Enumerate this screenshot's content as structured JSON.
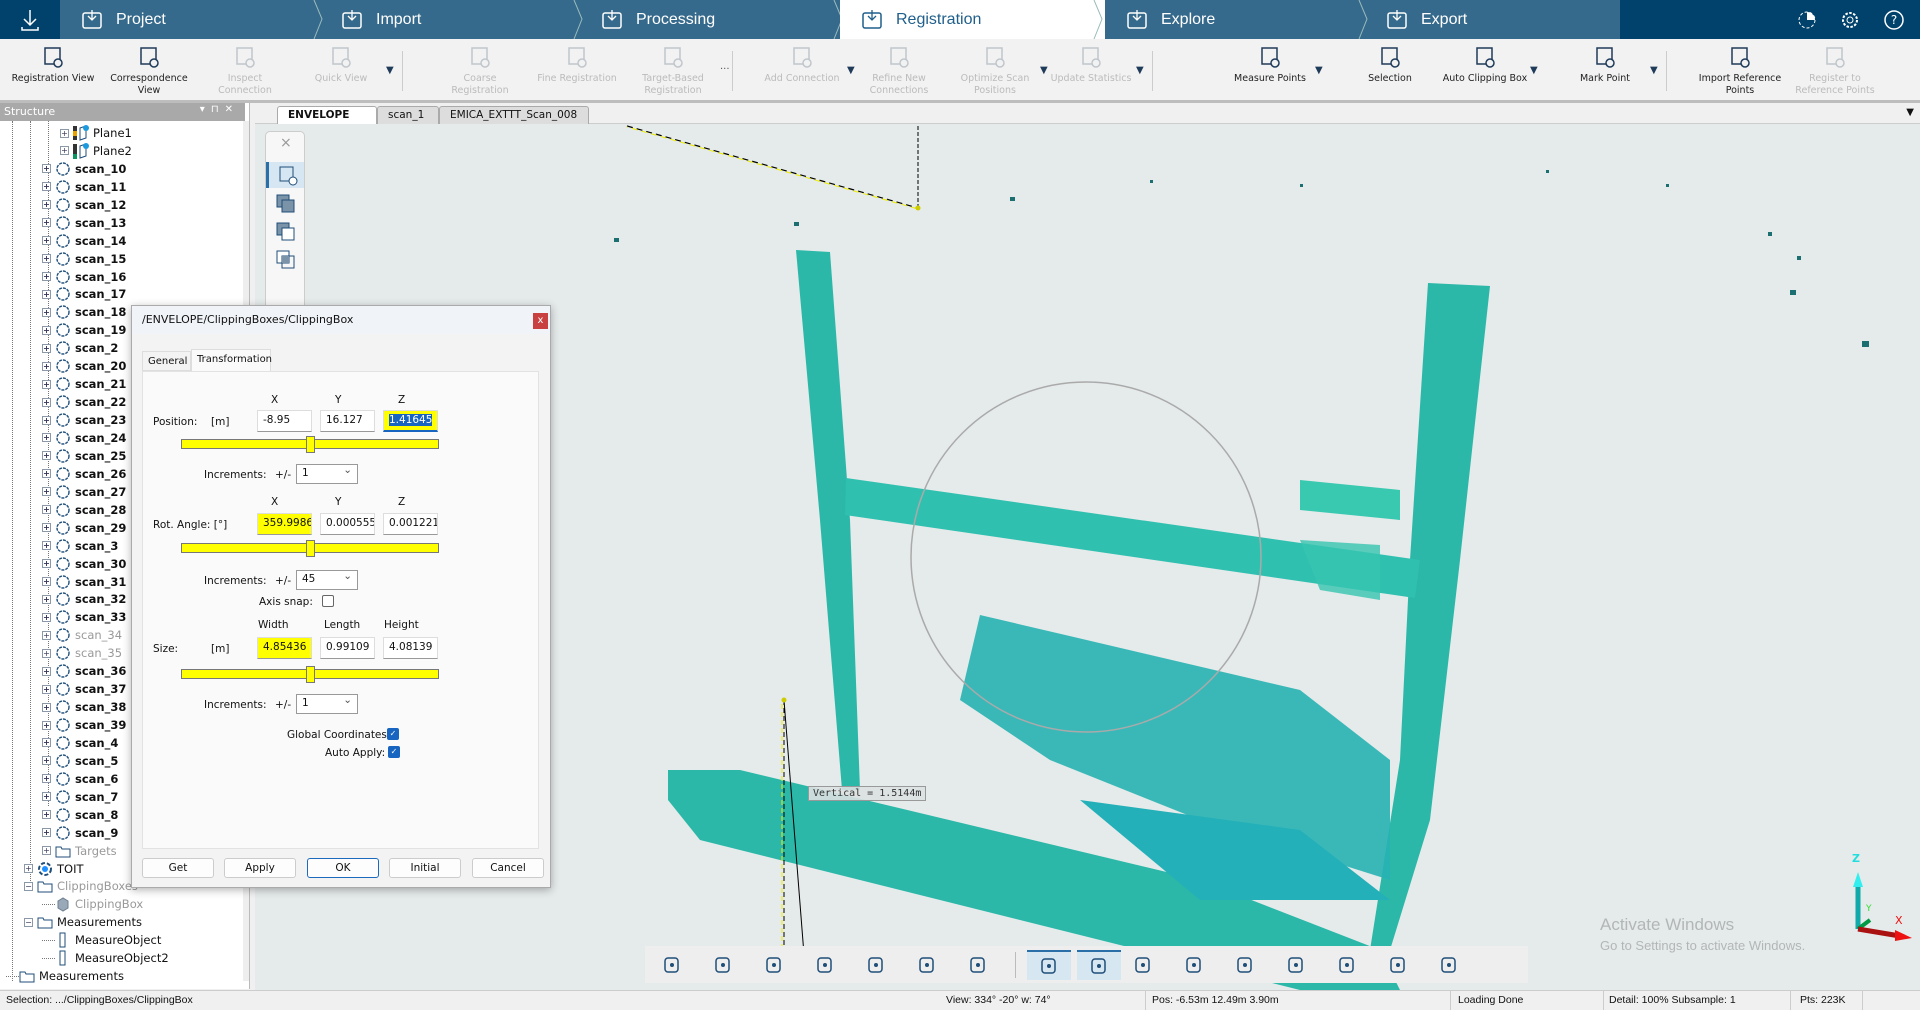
{
  "nav": {
    "tabs": [
      {
        "label": "Project",
        "icon": "folder-icon"
      },
      {
        "label": "Import",
        "icon": "import-icon"
      },
      {
        "label": "Processing",
        "icon": "processing-icon"
      },
      {
        "label": "Registration",
        "icon": "registration-icon",
        "active": true
      },
      {
        "label": "Explore",
        "icon": "explore-icon"
      },
      {
        "label": "Export",
        "icon": "export-icon"
      }
    ],
    "right_icons": [
      "progress-icon",
      "settings-icon",
      "help-icon"
    ],
    "colors": {
      "bar": "#366a8c",
      "dark": "#00426b",
      "active_text": "#1f5f8b"
    }
  },
  "toolbar": {
    "items": [
      {
        "label": "Registration View",
        "disabled": false,
        "icon": "registration-view-icon"
      },
      {
        "label": "Correspondence View",
        "disabled": false,
        "icon": "correspondence-view-icon"
      },
      {
        "label": "Inspect Connection",
        "disabled": true,
        "icon": "inspect-connection-icon"
      },
      {
        "label": "Quick View",
        "disabled": true,
        "icon": "quick-view-icon",
        "dropdown": true,
        "sep": true
      },
      {
        "label": "Coarse Registration",
        "disabled": true,
        "icon": "coarse-registration-icon"
      },
      {
        "label": "Fine Registration",
        "disabled": true,
        "icon": "fine-registration-icon"
      },
      {
        "label": "Target-Based Registration",
        "disabled": true,
        "icon": "target-registration-icon",
        "more": true,
        "sep": true
      },
      {
        "label": "Add Connection",
        "disabled": true,
        "icon": "add-connection-icon",
        "dropdown": true
      },
      {
        "label": "Refine New Connections",
        "disabled": true,
        "icon": "refine-connections-icon"
      },
      {
        "label": "Optimize Scan Positions",
        "disabled": true,
        "icon": "optimize-icon",
        "dropdown": true
      },
      {
        "label": "Update Statistics",
        "disabled": true,
        "icon": "statistics-icon",
        "dropdown": true,
        "sep": true
      },
      {
        "label": "Measure Points",
        "disabled": false,
        "icon": "measure-points-icon",
        "dropdown": true
      },
      {
        "label": "Selection",
        "disabled": false,
        "icon": "selection-icon"
      },
      {
        "label": "Auto Clipping Box",
        "disabled": false,
        "icon": "clipping-box-icon",
        "dropdown": true
      },
      {
        "label": "Mark Point",
        "disabled": false,
        "icon": "mark-point-icon",
        "dropdown": true,
        "sep": true
      },
      {
        "label": "Import Reference Points",
        "disabled": false,
        "icon": "import-reference-icon"
      },
      {
        "label": "Register to Reference Points",
        "disabled": true,
        "icon": "register-reference-icon"
      }
    ],
    "more_label": "..."
  },
  "structure": {
    "title": "Structure",
    "items": [
      {
        "label": "Plane1",
        "level": 3,
        "type": "plane",
        "bold": false,
        "gray": false
      },
      {
        "label": "Plane2",
        "level": 3,
        "type": "plane",
        "bold": false,
        "gray": false
      },
      {
        "label": "scan_10",
        "level": 2,
        "type": "scan",
        "bold": true
      },
      {
        "label": "scan_11",
        "level": 2,
        "type": "scan",
        "bold": true
      },
      {
        "label": "scan_12",
        "level": 2,
        "type": "scan",
        "bold": true
      },
      {
        "label": "scan_13",
        "level": 2,
        "type": "scan",
        "bold": true
      },
      {
        "label": "scan_14",
        "level": 2,
        "type": "scan",
        "bold": true
      },
      {
        "label": "scan_15",
        "level": 2,
        "type": "scan",
        "bold": true
      },
      {
        "label": "scan_16",
        "level": 2,
        "type": "scan",
        "bold": true
      },
      {
        "label": "scan_17",
        "level": 2,
        "type": "scan",
        "bold": true
      },
      {
        "label": "scan_18",
        "level": 2,
        "type": "scan",
        "bold": true
      },
      {
        "label": "scan_19",
        "level": 2,
        "type": "scan",
        "bold": true
      },
      {
        "label": "scan_2",
        "level": 2,
        "type": "scan",
        "bold": true
      },
      {
        "label": "scan_20",
        "level": 2,
        "type": "scan",
        "bold": true
      },
      {
        "label": "scan_21",
        "level": 2,
        "type": "scan",
        "bold": true
      },
      {
        "label": "scan_22",
        "level": 2,
        "type": "scan",
        "bold": true
      },
      {
        "label": "scan_23",
        "level": 2,
        "type": "scan",
        "bold": true
      },
      {
        "label": "scan_24",
        "level": 2,
        "type": "scan",
        "bold": true
      },
      {
        "label": "scan_25",
        "level": 2,
        "type": "scan",
        "bold": true
      },
      {
        "label": "scan_26",
        "level": 2,
        "type": "scan",
        "bold": true
      },
      {
        "label": "scan_27",
        "level": 2,
        "type": "scan",
        "bold": true
      },
      {
        "label": "scan_28",
        "level": 2,
        "type": "scan",
        "bold": true
      },
      {
        "label": "scan_29",
        "level": 2,
        "type": "scan",
        "bold": true
      },
      {
        "label": "scan_3",
        "level": 2,
        "type": "scan",
        "bold": true
      },
      {
        "label": "scan_30",
        "level": 2,
        "type": "scan",
        "bold": true
      },
      {
        "label": "scan_31",
        "level": 2,
        "type": "scan",
        "bold": true
      },
      {
        "label": "scan_32",
        "level": 2,
        "type": "scan",
        "bold": true
      },
      {
        "label": "scan_33",
        "level": 2,
        "type": "scan",
        "bold": true
      },
      {
        "label": "scan_34",
        "level": 2,
        "type": "scan",
        "gray": true
      },
      {
        "label": "scan_35",
        "level": 2,
        "type": "scan",
        "gray": true
      },
      {
        "label": "scan_36",
        "level": 2,
        "type": "scan",
        "bold": true
      },
      {
        "label": "scan_37",
        "level": 2,
        "type": "scan",
        "bold": true
      },
      {
        "label": "scan_38",
        "level": 2,
        "type": "scan",
        "bold": true
      },
      {
        "label": "scan_39",
        "level": 2,
        "type": "scan",
        "bold": true
      },
      {
        "label": "scan_4",
        "level": 2,
        "type": "scan",
        "bold": true
      },
      {
        "label": "scan_5",
        "level": 2,
        "type": "scan",
        "bold": true
      },
      {
        "label": "scan_6",
        "level": 2,
        "type": "scan",
        "bold": true
      },
      {
        "label": "scan_7",
        "level": 2,
        "type": "scan",
        "bold": true
      },
      {
        "label": "scan_8",
        "level": 2,
        "type": "scan",
        "bold": true
      },
      {
        "label": "scan_9",
        "level": 2,
        "type": "scan",
        "bold": true
      },
      {
        "label": "Targets",
        "level": 2,
        "type": "folder",
        "gray": true
      },
      {
        "label": "TOIT",
        "level": 1,
        "type": "toit"
      },
      {
        "label": "ClippingBoxes",
        "level": 1,
        "type": "folder",
        "gray": true,
        "expanded": true
      },
      {
        "label": "ClippingBox",
        "level": 2,
        "type": "box",
        "gray": true,
        "leaf": true
      },
      {
        "label": "Measurements",
        "level": 1,
        "type": "folder",
        "expanded": true
      },
      {
        "label": "MeasureObject",
        "level": 2,
        "type": "measure",
        "leaf": true
      },
      {
        "label": "MeasureObject2",
        "level": 2,
        "type": "measure",
        "leaf": true
      },
      {
        "label": "Measurements",
        "level": 0,
        "type": "folder",
        "leaf": true
      }
    ]
  },
  "view_tabs": [
    {
      "label": "ENVELOPE",
      "active": true,
      "close": "x"
    },
    {
      "label": "scan_1"
    },
    {
      "label": "EMICA_EXTTT_Scan_008"
    }
  ],
  "viewport": {
    "measurement_label": "Vertical = 1.5144m",
    "watermark_title": "Activate Windows",
    "watermark_sub": "Go to Settings to activate Windows.",
    "axes": {
      "x": "X",
      "y": "Y",
      "z": "Z"
    },
    "point_cloud_color": "#2bb8b0"
  },
  "dialog": {
    "title": "/ENVELOPE/ClippingBoxes/ClippingBox",
    "close": "x",
    "tabs": [
      "General",
      "Transformation"
    ],
    "active_tab": "Transformation",
    "position": {
      "label": "Position:",
      "unit": "[m]",
      "headers": [
        "X",
        "Y",
        "Z"
      ],
      "values": [
        "-8.95",
        "16.127",
        "1.41645"
      ],
      "increments": "1",
      "slider": 0.5
    },
    "rotation": {
      "label": "Rot. Angle: [°]",
      "headers": [
        "X",
        "Y",
        "Z"
      ],
      "values": [
        "359.99860",
        "0.000555",
        "0.001221"
      ],
      "increments": "45",
      "slider": 0.5
    },
    "axis_snap": {
      "label": "Axis snap:",
      "checked": false
    },
    "size": {
      "label": "Size:",
      "unit": "[m]",
      "headers": [
        "Width",
        "Length",
        "Height"
      ],
      "values": [
        "4.85436",
        "0.99109",
        "4.08139"
      ],
      "increments": "1",
      "slider": 0.5
    },
    "increments_label": "Increments:",
    "plusminus": "+/-",
    "global_coordinates": {
      "label": "Global Coordinates:",
      "checked": true
    },
    "auto_apply": {
      "label": "Auto Apply:",
      "checked": true
    },
    "buttons": [
      "Get",
      "Apply",
      "OK",
      "Initial",
      "Cancel"
    ]
  },
  "bottom_tools": [
    "navigation-mode-icon",
    "camera-views-icon",
    "zoom-icon",
    "box-view-icon",
    "rotate-icon",
    "undo-view-icon",
    "walk-icon",
    "clipping-box-display-icon",
    "cloud-display-icon",
    "split-view-icon",
    "point-density-icon",
    "box-mesh-icon",
    "dots-grid-icon",
    "dots-sparse-icon",
    "color-mode-icon",
    "shading-icon"
  ],
  "status": {
    "selection": "Selection: .../ClippingBoxes/ClippingBox",
    "view": "View: 334° -20° w: 74°",
    "pos": "Pos: -6.53m 12.49m 3.90m",
    "loading": "Loading Done",
    "detail": "Detail: 100%  Subsample:  1",
    "pts": "Pts: 223K"
  }
}
